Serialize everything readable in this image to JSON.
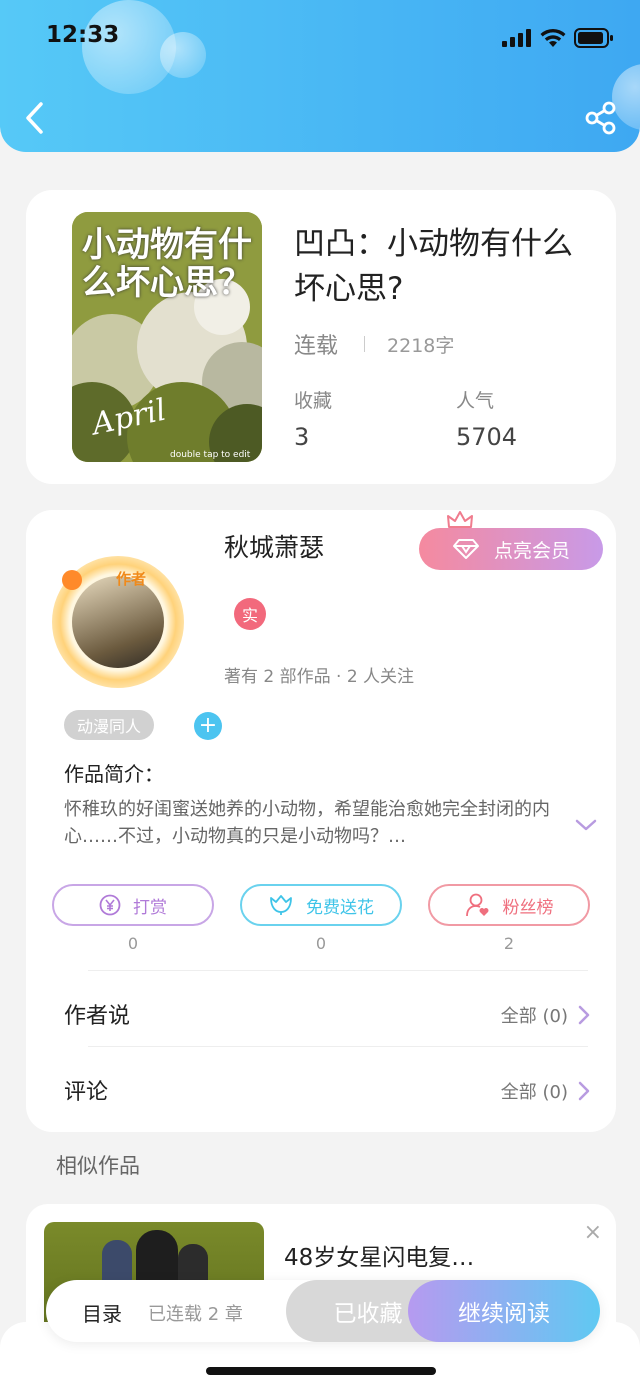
{
  "status_bar": {
    "time": "12:33"
  },
  "book": {
    "title": "凹凸：小动物有什么坏心思?",
    "status": "连载",
    "word_count": "2218字",
    "favorites_label": "收藏",
    "favorites_value": "3",
    "popularity_label": "人气",
    "popularity_value": "5704",
    "cover_text": "小动物有什么坏心思？",
    "cover_small": "April",
    "cover_caption": "double tap to edit"
  },
  "author": {
    "name": "秋城萧瑟",
    "vip_label": "点亮会员",
    "real_badge": "实",
    "stats": "著有 2 部作品 · 2 人关注",
    "avatar_badge": "作者",
    "tag": "动漫同人",
    "tag_add": "+"
  },
  "intro": {
    "title": "作品简介：",
    "text": "怀稚玖的好闺蜜送她养的小动物，希望能治愈她完全封闭的内心……不过，小动物真的只是小动物吗？…"
  },
  "actions": [
    {
      "label": "打赏",
      "count": "0",
      "color": "#b07ad8"
    },
    {
      "label": "免费送花",
      "count": "0",
      "color": "#3fc4e8"
    },
    {
      "label": "粉丝榜",
      "count": "2",
      "color": "#ef6f7e"
    }
  ],
  "rows": {
    "author_says_label": "作者说",
    "author_says_value": "全部 (0)",
    "comments_label": "评论",
    "comments_value": "全部 (0)"
  },
  "similar": {
    "section_title": "相似作品",
    "item_title": "48岁女星闪电复…",
    "close": "×"
  },
  "bottom_bar": {
    "catalog": "目录",
    "updated": "已连载 2 章",
    "collected": "已收藏",
    "continue": "继续阅读"
  }
}
